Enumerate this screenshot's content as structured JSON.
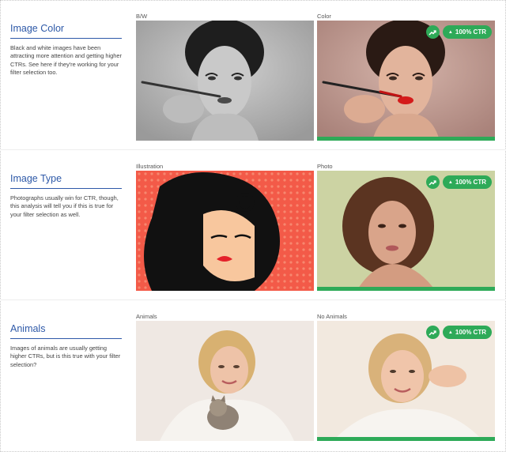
{
  "sections": [
    {
      "title": "Image Color",
      "description": "Black and white images have been attracting more attention and getting higher CTRs. See here if they're working for your filter selection too.",
      "left": {
        "label": "B/W",
        "image_alt": "black and white portrait of woman applying lipstick"
      },
      "right": {
        "label": "Color",
        "image_alt": "color portrait of woman applying red lipstick",
        "badge": "100% CTR",
        "winner": true
      }
    },
    {
      "title": "Image Type",
      "description": "Photographs usually win for CTR, though, this analysis will tell you if this is true for your filter selection as well.",
      "left": {
        "label": "Illustration",
        "image_alt": "pop art illustration of woman with black hair"
      },
      "right": {
        "label": "Photo",
        "image_alt": "photo of woman with curly brown bob",
        "badge": "100% CTR",
        "winner": true
      }
    },
    {
      "title": "Animals",
      "description": "Images of animals are usually getting higher CTRs, but is this true with your filter selection?",
      "left": {
        "label": "Animals",
        "image_alt": "blonde woman lying with kitten"
      },
      "right": {
        "label": "No Animals",
        "image_alt": "blonde woman lying smiling",
        "badge": "100% CTR",
        "winner": true
      }
    }
  ],
  "colors": {
    "accent": "#2e59a8",
    "success": "#2eaa58"
  },
  "icons": {
    "trend": "trending-up-icon",
    "up": "caret-up-icon"
  }
}
